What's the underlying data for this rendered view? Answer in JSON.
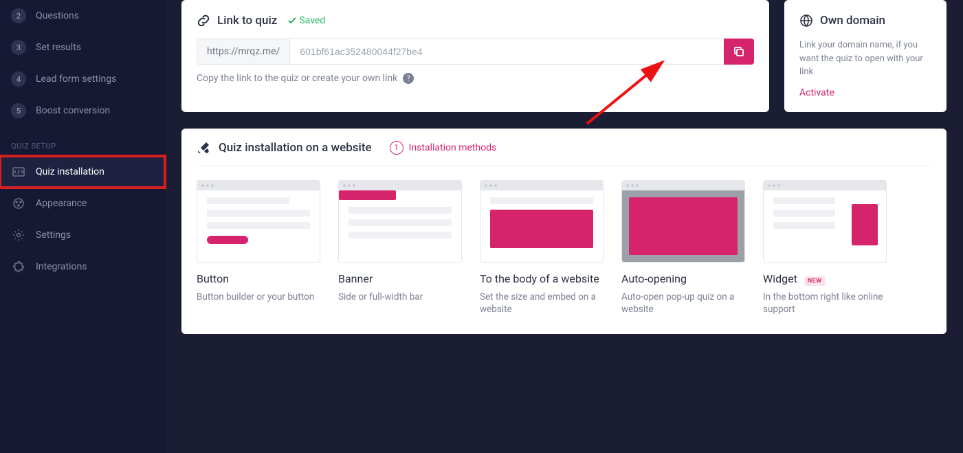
{
  "sidebar": {
    "steps": [
      {
        "num": "2",
        "label": "Questions"
      },
      {
        "num": "3",
        "label": "Set results"
      },
      {
        "num": "4",
        "label": "Lead form settings"
      },
      {
        "num": "5",
        "label": "Boost conversion"
      }
    ],
    "section_label": "QUIZ SETUP",
    "setup": [
      {
        "label": "Quiz installation",
        "active": true
      },
      {
        "label": "Appearance"
      },
      {
        "label": "Settings"
      },
      {
        "label": "Integrations"
      }
    ]
  },
  "link_card": {
    "title": "Link to quiz",
    "saved": "Saved",
    "prefix": "https://mrqz.me/",
    "value": "601bf61ac352480044f27be4",
    "hint": "Copy the link to the quiz or create your own link"
  },
  "domain_card": {
    "title": "Own domain",
    "desc": "Link your domain name, if you want the quiz to open with your link",
    "activate": "Activate"
  },
  "install": {
    "title": "Quiz installation on a website",
    "methods_num": "1",
    "methods_label": "Installation methods",
    "options": [
      {
        "title": "Button",
        "desc": "Button builder or your button"
      },
      {
        "title": "Banner",
        "desc": "Side or full-width bar"
      },
      {
        "title": "To the body of a website",
        "desc": "Set the size and embed on a website"
      },
      {
        "title": "Auto-opening",
        "desc": "Auto-open pop-up quiz on a website"
      },
      {
        "title": "Widget",
        "desc": "In the bottom right like online support",
        "badge": "NEW"
      }
    ]
  }
}
